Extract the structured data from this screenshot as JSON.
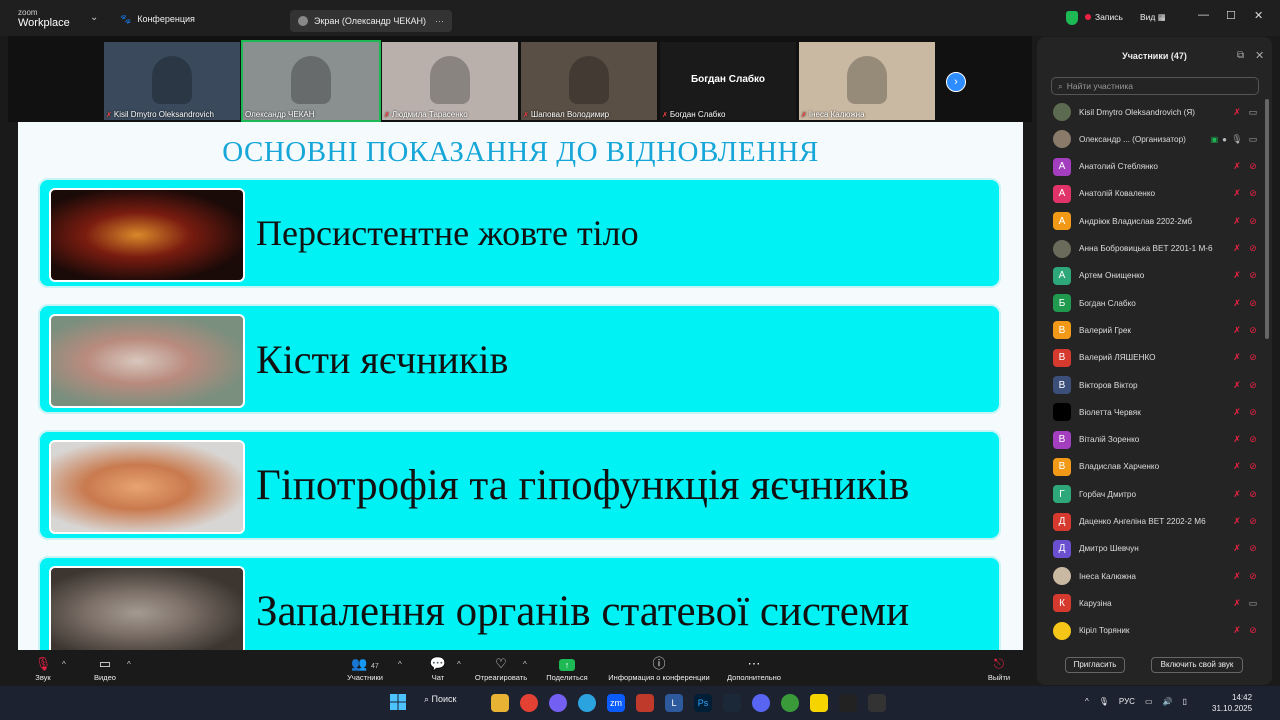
{
  "app": {
    "brand_top": "zoom",
    "brand_bottom": "Workplace",
    "tab_conference": "Конференция",
    "tab_screen": "Экран (Олександр ЧЕКАН)",
    "record_label": "Запись",
    "view_label": "Вид"
  },
  "thumbnails": [
    {
      "name": "Kisil Dmytro Oleksandrovich",
      "muted": true,
      "bg": "#3a4a5c"
    },
    {
      "name": "Олександр ЧЕКАН",
      "muted": false,
      "bg": "#8a8f90",
      "active": true
    },
    {
      "name": "Людмила Тарасенко",
      "muted": true,
      "bg": "#b9b0ac"
    },
    {
      "name": "Шаповал Володимир",
      "muted": true,
      "bg": "#5a4f45"
    },
    {
      "name": "Богдан Слабко",
      "muted": true,
      "bg": "#1a1a1a",
      "big_name": "Богдан Слабко"
    },
    {
      "name": "Інеса Калюжна",
      "muted": true,
      "bg": "#c9b8a2"
    }
  ],
  "slide": {
    "title": "ОСНОВНІ ПОКАЗАННЯ ДО ВІДНОВЛЕННЯ",
    "items": [
      {
        "text": "Персистентне жовте тіло",
        "pic_colors": [
          "#1a0a08",
          "#d9892a",
          "#7a1c10"
        ]
      },
      {
        "text": "Кісти яєчників",
        "pic_colors": [
          "#7a8f7e",
          "#d8c7bd",
          "#b98b7e"
        ]
      },
      {
        "text": "Гіпотрофія та гіпофункція яєчників",
        "pic_colors": [
          "#d8d6d4",
          "#e8a372",
          "#c97a4e"
        ]
      },
      {
        "text": "Запалення органів статевої системи",
        "pic_colors": [
          "#3c3530",
          "#a59a92",
          "#7a6e66"
        ]
      }
    ]
  },
  "participants": {
    "title": "Участники (47)",
    "search_placeholder": "Найти участника",
    "list": [
      {
        "name": "Kisil Dmytro Oleksandrovich (Я)",
        "letter": "",
        "color": "#5c6b4f",
        "photo": true
      },
      {
        "name": "Олександр ...  (Организатор)",
        "letter": "",
        "color": "#8a7a6a",
        "photo": true,
        "organizer": true
      },
      {
        "name": "Анатолий Стеблянко",
        "letter": "А",
        "color": "#a33fbf"
      },
      {
        "name": "Анатолій Коваленко",
        "letter": "А",
        "color": "#e0336a"
      },
      {
        "name": "Андрiюк Владислав 2202-2мб",
        "letter": "А",
        "color": "#f29a17"
      },
      {
        "name": "Анна Бобровицька ВЕТ 2201-1 М-6",
        "letter": "",
        "color": "#6b6b5c",
        "photo": true
      },
      {
        "name": "Артем Онищенко",
        "letter": "А",
        "color": "#2ea77b"
      },
      {
        "name": "Богдан Слабко",
        "letter": "Б",
        "color": "#1f9a4e"
      },
      {
        "name": "Валерий Грек",
        "letter": "В",
        "color": "#f29a17"
      },
      {
        "name": "Валерий ЛЯШЕНКО",
        "letter": "В",
        "color": "#d63a2f"
      },
      {
        "name": "Вікторов Віктор",
        "letter": "В",
        "color": "#3b4f7a"
      },
      {
        "name": "Віолетта Червяк",
        "letter": "",
        "color": "#000000"
      },
      {
        "name": "Віталій Зоренко",
        "letter": "В",
        "color": "#a33fbf"
      },
      {
        "name": "Владислав Харченко",
        "letter": "В",
        "color": "#f29a17"
      },
      {
        "name": "Горбач Дмитро",
        "letter": "Г",
        "color": "#2ea77b"
      },
      {
        "name": "Даценко Ангеліна ВЕТ 2202-2 М6",
        "letter": "Д",
        "color": "#d63a2f"
      },
      {
        "name": "Дмитро Шевчун",
        "letter": "Д",
        "color": "#6a4fcf"
      },
      {
        "name": "Інеса Калюжна",
        "letter": "",
        "color": "#c9b8a2",
        "photo": true
      },
      {
        "name": "Карузіна",
        "letter": "К",
        "color": "#d63a2f"
      },
      {
        "name": "Кірiл Торяник",
        "letter": "",
        "color": "#f5c518",
        "photo": true
      }
    ],
    "invite_label": "Пригласить",
    "unmute_label": "Включить свой звук"
  },
  "toolbar": {
    "audio": "Звук",
    "video": "Видео",
    "participants": "Участники",
    "participants_count": "47",
    "chat": "Чат",
    "react": "Отреагировать",
    "share": "Поделиться",
    "info": "Информация о конференции",
    "more": "Дополнительно",
    "leave": "Выйти"
  },
  "taskbar": {
    "search": "Поиск",
    "lang": "РУС",
    "time": "14:42",
    "date": "31.10.2025"
  }
}
